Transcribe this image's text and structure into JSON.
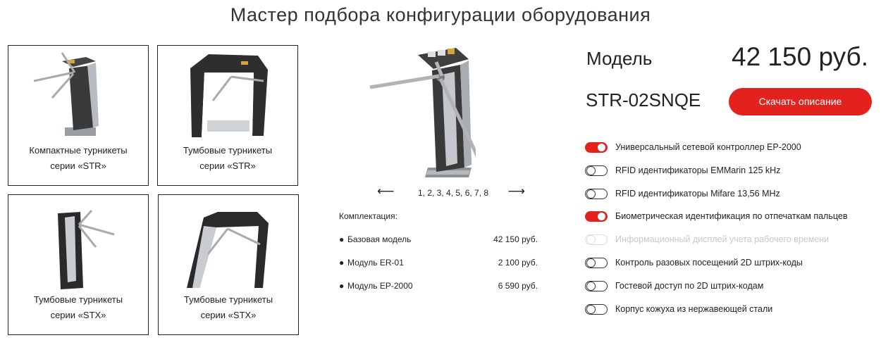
{
  "page": {
    "title": "Мастер подбора конфигурации оборудования"
  },
  "catalog": [
    {
      "line1": "Компактные турникеты",
      "line2": "серии «STR»"
    },
    {
      "line1": "Тумбовые турникеты",
      "line2": "серии «STR»"
    },
    {
      "line1": "Тумбовые турникеты",
      "line2": "серии «STX»"
    },
    {
      "line1": "Тумбовые турникеты",
      "line2": "серии «STX»"
    }
  ],
  "gallery": {
    "prev": "⟵",
    "next": "⟶",
    "pages": "1, 2, 3, 4, 5, 6, 7, 8"
  },
  "kit": {
    "title": "Комплектация:",
    "items": [
      {
        "bullet": "●",
        "name": "Базовая модель",
        "price": "42 150 руб."
      },
      {
        "bullet": "●",
        "name": "Модуль ER-01",
        "price": "2 100 руб."
      },
      {
        "bullet": "●",
        "name": "Модуль EP-2000",
        "price": "6 590 руб."
      }
    ]
  },
  "summary": {
    "model_label": "Модель",
    "price": "42 150 руб.",
    "model_code": "STR-02SNQE",
    "download_label": "Скачать описание"
  },
  "options": [
    {
      "label": "Универсальный сетевой контроллер EP-2000",
      "state": "on"
    },
    {
      "label": "RFID идентификаторы EMMarin 125 kHz",
      "state": "off"
    },
    {
      "label": "RFID идентификаторы Mifare 13,56 MHz",
      "state": "off"
    },
    {
      "label": "Биометрическая идентификация по отпечаткам пальцев",
      "state": "on"
    },
    {
      "label": "Информационный дисплей учета рабочего времени",
      "state": "disabled"
    },
    {
      "label": "Контроль разовых посещений 2D штрих-коды",
      "state": "off"
    },
    {
      "label": "Гостевой доступ по 2D штрих-кодам",
      "state": "off"
    },
    {
      "label": "Корпус кожуха из нержавеющей стали",
      "state": "off"
    }
  ],
  "colors": {
    "accent": "#e3211d",
    "text": "#222222",
    "disabled": "#c8c8c8"
  }
}
